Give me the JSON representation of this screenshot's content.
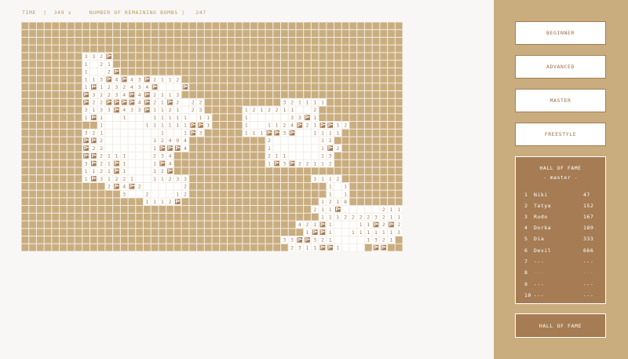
{
  "status": {
    "time_label": "TIME",
    "separator": "|",
    "time_value": "349 s",
    "bombs_label": "NUMBER OF REMAINING BOMBS",
    "bombs_value": "247"
  },
  "board": {
    "columns": 50,
    "rows": 30,
    "colors": {
      "hidden": "#c9ad7f",
      "grid": "#f3ede4",
      "revealed": "#ffffff",
      "digit": "#a57c53",
      "flag": "#a57c53"
    },
    "cell_states": "H = hidden, ' ' = revealed empty, 1-8 = revealed number, F = flag",
    "grid": [
      "HHHHHHHHHHHHHHHHHHHHHHHHHHHHHHHHHHHHHHHHHHHHHHHHHH",
      "HHHHHHHHHHHHHHHHHHHHHHHHHHHHHHHHHHHHHHHHHHHHHHHHHH",
      "HHHHHHHHHHHHHHHHHHHHHHHHHHHHHHHHHHHHHHHHHHHHHHHHHH",
      "HHHHHHHHHHHHHHHHHHHHHHHHHHHHHHHHHHHHHHHHHHHHHHHHHH",
      "HHHHHHHH332FHHHHHHHHHHHHHHHHHHHHHHHHHHHHHHHHHHHHHH",
      "HHHHHHHH1 21HHHHHHHHHHHHHHHHHHHHHHHHHHHHHHHHHHHHHH",
      "HHHHHHHH1  2FHHHHHHHHHHHHHHHHHHHHHHHHHHHHHHHHHHHHH",
      "HHHHHHHH113F4F43F2112HHHHHHHHHHHHHHHHHHHHHHHHHHHHH",
      "HHHHHHHH1F1232434F   FHHHHHHHHHHHHHHHHHHHHHHHHHHHH",
      "HHHHHHHHF32234F4F2113HHHHHHHHHHHHHHHHHHHHHHHHHHHHH",
      "HHHHHHHHF22FFFF4F21F2 22HHHHHHHHHH321111HHHHHHHHHH",
      "HHHHHHHH3133F433F1121 23HHHHH1212211  2HHHHHHHHHHH",
      "HHHHHHHH1F1  1   11111 11HHHH1     33F1HHHHHHHHHHH",
      "HHHHHHHHHH1     111111FF1HHHH1  1124F21FF12HHHHHHH",
      "HHHHHHHH321       1  1F3HHHHH111FF3F  1111HHHHHHHH",
      "HHHHHHHHFF2      12494HHHHHHHHHH2      12HHHHHHHHH",
      "HHHHHHHHF22      1FFF4HHHHHHHHHH1      1F2HHHHHHHH",
      "HHHHHHHHFF2111   234HHHHHHHHHHHH211    13HHHHHHHHH",
      "HHHHHHHH3F21F1   1F4HHHHHHHHHHHH1F3F22112HHHHHHHHH",
      "HHHHHHHH1121F1   12FHHHHHHHHHHHHHHHHHHHHHHHHHHHHHH",
      "HHHHHHHH1F31221  11233HHHHHHHHHHHHHHHH3112HHHHHHHH",
      "HHHHHHHHHHH2F4F2     2HHHHHHHHHHHHHHHHHH1 1HHHHHHH",
      "HHHHHHHHHHHHH3  2   12HHHHHHHHHHHHHHHHHH1 1HHHHHHH",
      "HHHHHHHHHHHHHHHH1112FHHHHHHHHHHHHHHHHHH1218HHHHHHH",
      "HHHHHHHHHHHHHHHHHHHHHHHHHHHHHHHHHHHHHH211F     211",
      "HHHHHHHHHHHHHHHHHHHHHHHHHHHHHHHHHHHHHHH11122223211",
      "HHHHHHHHHHHHHHHHHHHHHHHHHHHHHHHHHHHH421F1   11F2F2",
      "HHHHHHHHHHHHHHHHHHHHHHHHHHHHHHHHHHHHH1FF1  1111113",
      "HHHHHHHHHHHHHHHHHHHHHHHHHHHHHHHHHH33FF321    1321",
      "HHHHHHHHHHHHHHHHHHHHHHHHHHHHHHHHHHH2311FF1   HFFHH"
    ]
  },
  "sidebar": {
    "buttons": [
      "BEGINNER",
      "ADVANCED",
      "MASTER",
      "FREESTYLE"
    ],
    "hall_of_fame": {
      "title": "HALL OF FAME",
      "subtitle": "- master -",
      "entries": [
        {
          "rank": "1",
          "name": "Niki",
          "score": "47"
        },
        {
          "rank": "2",
          "name": "Tatya",
          "score": "152"
        },
        {
          "rank": "3",
          "name": "Rudo",
          "score": "167"
        },
        {
          "rank": "4",
          "name": "Dorka",
          "score": "189"
        },
        {
          "rank": "5",
          "name": "Dia",
          "score": "333"
        },
        {
          "rank": "6",
          "name": "Devil",
          "score": "666"
        },
        {
          "rank": "7",
          "name": "---",
          "score": "---"
        },
        {
          "rank": "8",
          "name": "---",
          "score": "---"
        },
        {
          "rank": "9",
          "name": "---",
          "score": "---"
        },
        {
          "rank": "10",
          "name": "---",
          "score": "---"
        }
      ]
    },
    "hall_of_fame_button": "HALL OF FAME"
  }
}
